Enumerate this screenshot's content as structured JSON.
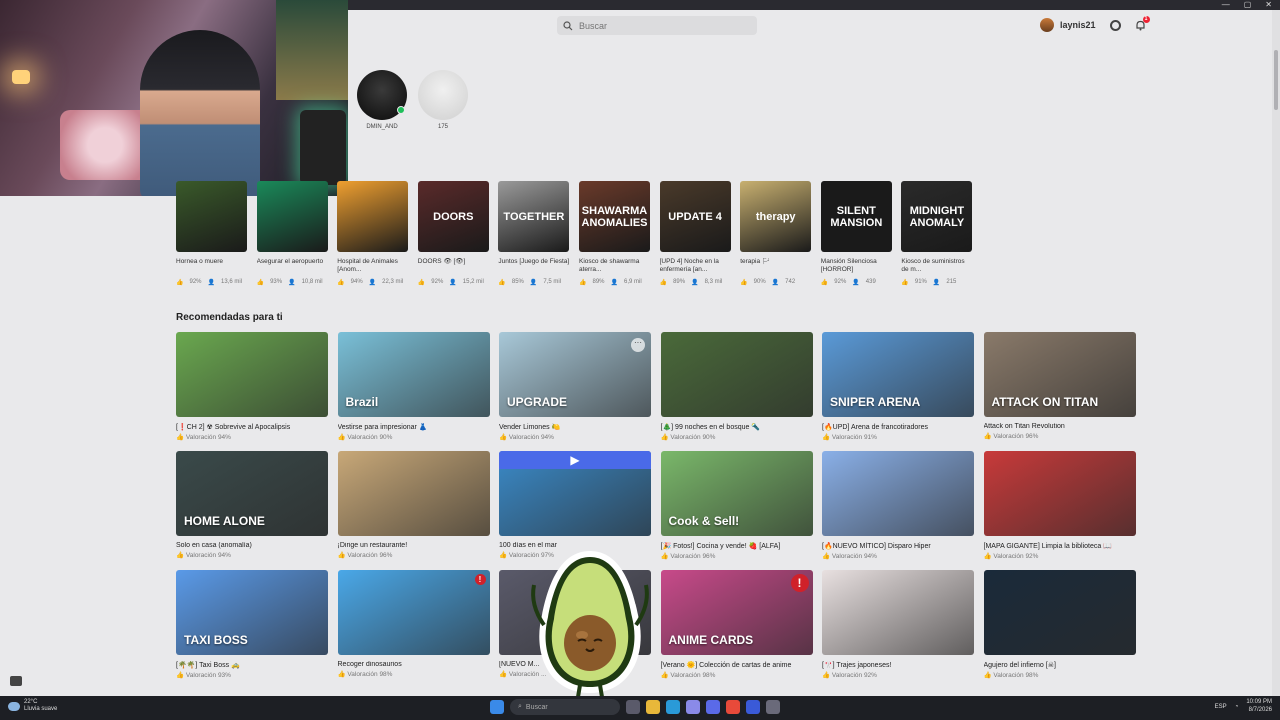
{
  "header": {
    "search_placeholder": "Buscar",
    "username": "laynis21",
    "notification_count": "1"
  },
  "window_controls": [
    "—",
    "▢",
    "✕"
  ],
  "friends": [
    {
      "name": "DMIN_AND",
      "online": true
    },
    {
      "name": "175",
      "online": false
    }
  ],
  "continue_games": [
    {
      "title": "Hornea o muere",
      "rating": "92%",
      "players": "13,6 mil",
      "color": "#3a5a2a",
      "thumb_text": ""
    },
    {
      "title": "Asegurar el aeropuerto",
      "rating": "93%",
      "players": "10,8 mil",
      "color": "#1a8a5a",
      "thumb_text": ""
    },
    {
      "title": "Hospital de Animales [Anom...",
      "rating": "94%",
      "players": "22,3 mil",
      "color": "#f0a030",
      "thumb_text": ""
    },
    {
      "title": "DOORS 👁 [👁]",
      "rating": "92%",
      "players": "15,2 mil",
      "color": "#5a2a2a",
      "thumb_text": "DOORS"
    },
    {
      "title": "Juntos [Juego de Fiesta]",
      "rating": "85%",
      "players": "7,5 mil",
      "color": "#9a9a9a",
      "thumb_text": "TOGETHER"
    },
    {
      "title": "Kiosco de shawarma aterra...",
      "rating": "89%",
      "players": "6,9 mil",
      "color": "#6a3a2a",
      "thumb_text": "SHAWARMA ANOMALIES"
    },
    {
      "title": "[UPD 4] Noche en la enfermería [an...",
      "rating": "89%",
      "players": "8,3 mil",
      "color": "#4a3a2a",
      "thumb_text": "UPDATE 4"
    },
    {
      "title": "terapia 🏳",
      "rating": "90%",
      "players": "742",
      "color": "#c8b070",
      "thumb_text": "therapy"
    },
    {
      "title": "Mansión Silenciosa [HORROR]",
      "rating": "92%",
      "players": "439",
      "color": "#1a1a1a",
      "thumb_text": "SILENT MANSION"
    },
    {
      "title": "Kiosco de suministros de m...",
      "rating": "91%",
      "players": "215",
      "color": "#2a2a2a",
      "thumb_text": "MIDNIGHT ANOMALY"
    }
  ],
  "recommended_title": "Recomendadas para ti",
  "recommended": [
    {
      "title": "[❗CH 2] ☢ Sobrevive al Apocalipsis",
      "rating": "Valoración 94%",
      "color": "#6aa84f",
      "thumb_text": "",
      "badge": false,
      "play": false
    },
    {
      "title": "Vestirse para impresionar 👗",
      "rating": "Valoración 90%",
      "color": "#7ac0d8",
      "thumb_text": "Brazil",
      "badge": false,
      "play": false
    },
    {
      "title": "Vender Limones 🍋",
      "rating": "Valoración 94%",
      "color": "#a8c8d8",
      "thumb_text": "UPGRADE",
      "badge": false,
      "play": false
    },
    {
      "title": "[🎄] 99 noches en el bosque 🔦",
      "rating": "Valoración 90%",
      "color": "#4a6a3a",
      "thumb_text": "",
      "badge": false,
      "play": false
    },
    {
      "title": "[🔥UPD] Arena de francotiradores",
      "rating": "Valoración 91%",
      "color": "#5a9ad8",
      "thumb_text": "SNIPER ARENA",
      "badge": false,
      "play": false
    },
    {
      "title": "Attack on Titan Revolution",
      "rating": "Valoración 96%",
      "color": "#8a7a6a",
      "thumb_text": "ATTACK ON TITAN",
      "badge": false,
      "play": false
    },
    {
      "title": "Solo en casa (anomalía)",
      "rating": "Valoración 94%",
      "color": "#3a4a4a",
      "thumb_text": "HOME ALONE",
      "badge": false,
      "play": false
    },
    {
      "title": "¡Dirige un restaurante!",
      "rating": "Valoración 96%",
      "color": "#c8a878",
      "thumb_text": "",
      "badge": false,
      "play": false
    },
    {
      "title": "100 días en el mar",
      "rating": "Valoración 97%",
      "color": "#3a8ac8",
      "thumb_text": "",
      "badge": false,
      "play": true
    },
    {
      "title": "[🎉 Fotos!] Cocina y vende! 🍓 [ALFA]",
      "rating": "Valoración 96%",
      "color": "#7ab86a",
      "thumb_text": "Cook & Sell!",
      "badge": false,
      "play": false
    },
    {
      "title": "[🔥NUEVO MÍTICO] Disparo Hiper",
      "rating": "Valoración 94%",
      "color": "#8ab0e8",
      "thumb_text": "",
      "badge": false,
      "play": false
    },
    {
      "title": "[MAPA GIGANTE] Limpia la biblioteca 📖",
      "rating": "Valoración 92%",
      "color": "#c83a3a",
      "thumb_text": "",
      "badge": false,
      "play": false
    },
    {
      "title": "[🌴🌴] Taxi Boss 🚕",
      "rating": "Valoración 93%",
      "color": "#5a9ae8",
      "thumb_text": "TAXI BOSS",
      "badge": false,
      "play": false
    },
    {
      "title": "Recoger dinosaurios",
      "rating": "Valoración 98%",
      "color": "#4aa8e8",
      "thumb_text": "",
      "badge": true,
      "play": false
    },
    {
      "title": "[NUEVO M...",
      "rating": "Valoración ...",
      "color": "#5a5a6a",
      "thumb_text": "",
      "badge": false,
      "play": false
    },
    {
      "title": "[Verano 🌞] Colección de cartas de anime",
      "rating": "Valoración 98%",
      "color": "#c84a8a",
      "thumb_text": "ANIME CARDS",
      "badge": true,
      "play": false
    },
    {
      "title": "[🎌] Trajes japoneses!",
      "rating": "Valoración 92%",
      "color": "#e8e0e0",
      "thumb_text": "",
      "badge": false,
      "play": false
    },
    {
      "title": "Agujero del infierno [☠]",
      "rating": "Valoración 98%",
      "color": "#1a2a3a",
      "thumb_text": "",
      "badge": false,
      "play": false
    }
  ],
  "taskbar": {
    "weather_temp": "22°C",
    "weather_desc": "Lluvia suave",
    "search_label": "Buscar",
    "lang": "ESP",
    "time": "10:09 PM",
    "date": "8/7/2026"
  }
}
